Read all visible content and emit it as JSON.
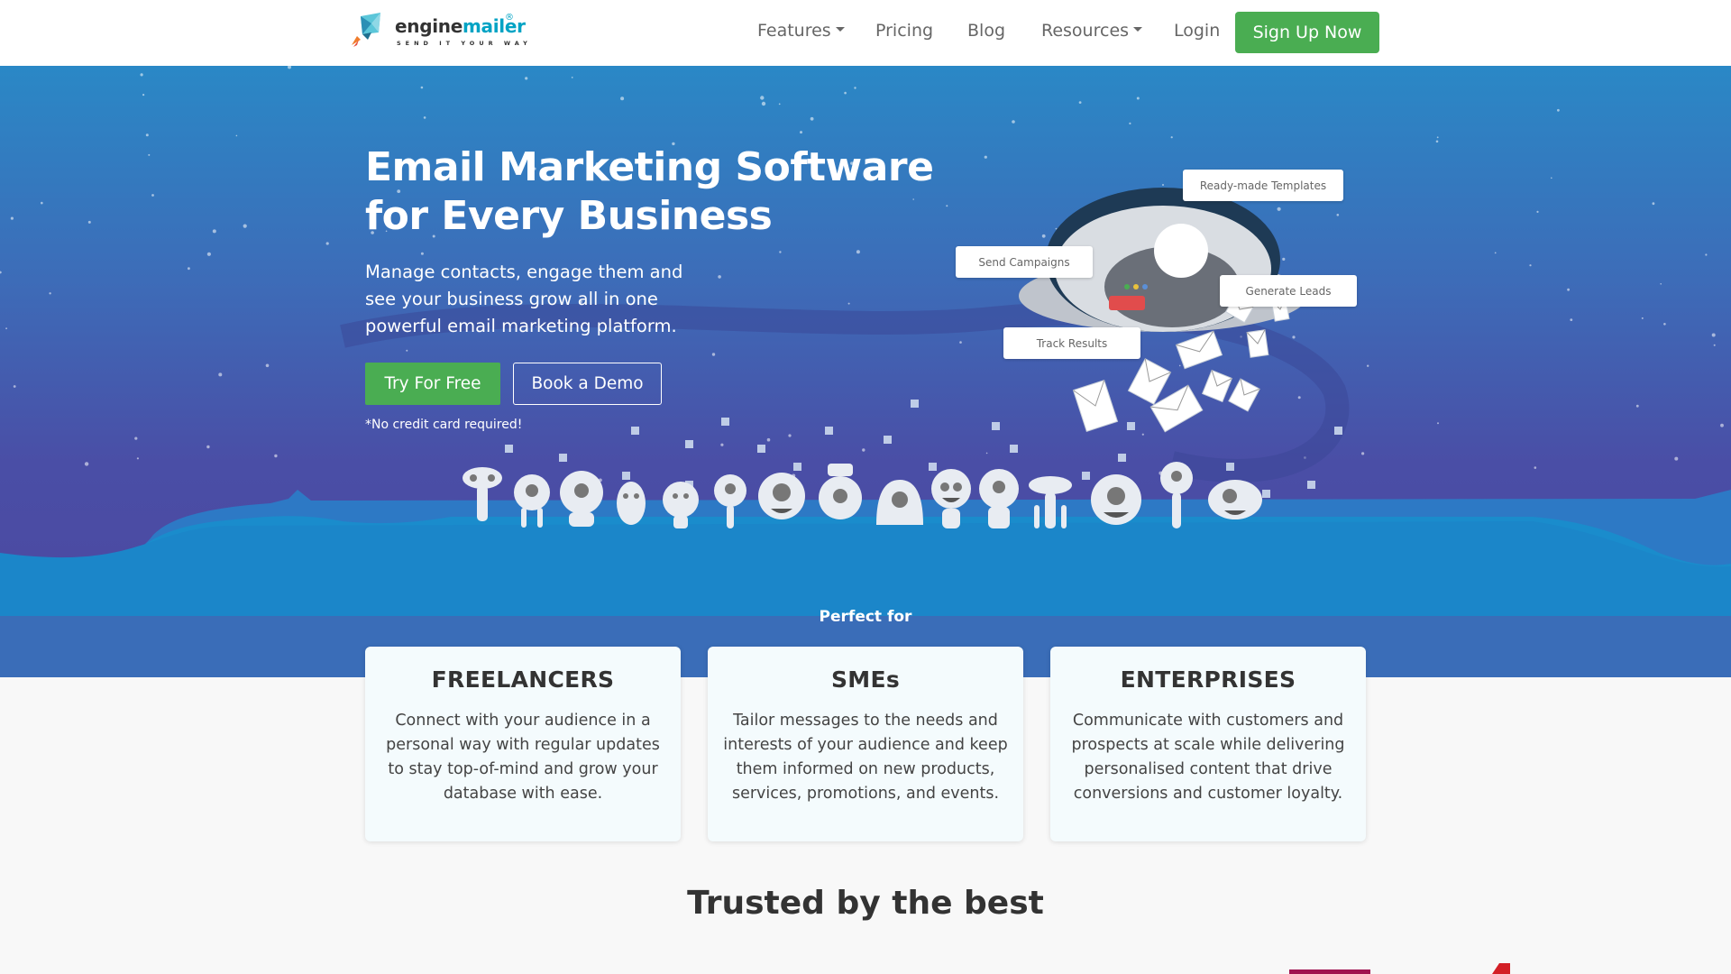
{
  "nav": {
    "logo": {
      "engine": "engine",
      "mailer": "mailer",
      "reg": "®",
      "tagline": "SEND IT YOUR WAY"
    },
    "links": [
      {
        "label": "Features",
        "dropdown": true
      },
      {
        "label": "Pricing",
        "dropdown": false
      },
      {
        "label": "Blog",
        "dropdown": false
      },
      {
        "label": "Resources",
        "dropdown": true
      },
      {
        "label": "Login",
        "dropdown": false
      }
    ],
    "signup": "Sign Up Now"
  },
  "hero": {
    "title_line1": "Email Marketing Software",
    "title_line2": "for Every Business",
    "subtitle_line1": "Manage contacts, engage them and",
    "subtitle_line2": "see your business grow all in one",
    "subtitle_line3": "powerful email marketing platform.",
    "try_button": "Try For Free",
    "demo_button": "Book a Demo",
    "no_credit": "*No credit card required!",
    "feature_labels": {
      "templates": "Ready-made Templates",
      "campaigns": "Send Campaigns",
      "leads": "Generate Leads",
      "results": "Track Results"
    },
    "perfect_for": "Perfect for"
  },
  "cards": [
    {
      "title": "FREELANCERS",
      "text": "Connect with your audience in a personal way with regular updates to stay top-of-mind and grow your database with ease."
    },
    {
      "title": "SMEs",
      "text": "Tailor messages to the needs and interests of your audience and keep them informed on new products, services, promotions, and events."
    },
    {
      "title": "ENTERPRISES",
      "text": "Communicate with customers and prospects at scale while delivering personalised content that drive conversions and customer loyalty."
    }
  ],
  "trusted": "Trusted by the best",
  "colors": {
    "brand_green": "#4aad52",
    "brand_cyan": "#00a3c4",
    "hero_top": "#2a88c6",
    "hero_bottom": "#4d479f",
    "ground": "#1a8ccc"
  }
}
